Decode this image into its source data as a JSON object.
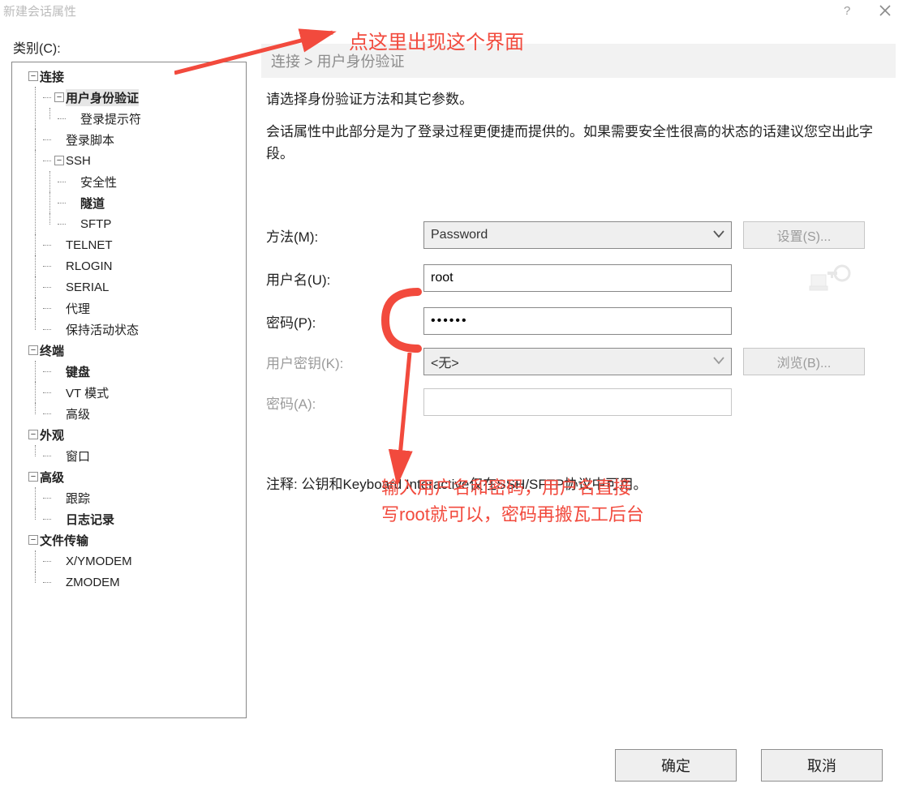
{
  "window": {
    "title": "新建会话属性"
  },
  "sidebar": {
    "label": "类别(C):",
    "tree": {
      "connection": {
        "label": "连接",
        "bold": true
      },
      "auth": {
        "label": "用户身份验证",
        "bold": true,
        "selected": true
      },
      "login_prompt": {
        "label": "登录提示符"
      },
      "login_script": {
        "label": "登录脚本"
      },
      "ssh": {
        "label": "SSH"
      },
      "security": {
        "label": "安全性"
      },
      "tunnel": {
        "label": "隧道",
        "bold": true
      },
      "sftp": {
        "label": "SFTP"
      },
      "telnet": {
        "label": "TELNET"
      },
      "rlogin": {
        "label": "RLOGIN"
      },
      "serial": {
        "label": "SERIAL"
      },
      "proxy": {
        "label": "代理"
      },
      "keepalive": {
        "label": "保持活动状态"
      },
      "terminal": {
        "label": "终端",
        "bold": true
      },
      "keyboard": {
        "label": "键盘",
        "bold": true
      },
      "vtmode": {
        "label": "VT 模式"
      },
      "advanced_t": {
        "label": "高级"
      },
      "appearance": {
        "label": "外观",
        "bold": true
      },
      "window": {
        "label": "窗口"
      },
      "advanced": {
        "label": "高级",
        "bold": true
      },
      "trace": {
        "label": "跟踪"
      },
      "logging": {
        "label": "日志记录",
        "bold": true
      },
      "filetransfer": {
        "label": "文件传输",
        "bold": true
      },
      "xymodem": {
        "label": "X/YMODEM"
      },
      "zmodem": {
        "label": "ZMODEM"
      }
    }
  },
  "panel": {
    "breadcrumb": "连接 > 用户身份验证",
    "desc_line1": "请选择身份验证方法和其它参数。",
    "desc_line2": "会话属性中此部分是为了登录过程更便捷而提供的。如果需要安全性很高的状态的话建议您空出此字段。",
    "form": {
      "method_label": "方法(M):",
      "method_value": "Password",
      "settings_btn": "设置(S)...",
      "user_label": "用户名(U):",
      "user_value": "root",
      "pass_label": "密码(P):",
      "pass_value": "••••••",
      "userkey_label": "用户密钥(K):",
      "userkey_value": "<无>",
      "browse_btn": "浏览(B)...",
      "passphrase_label": "密码(A):"
    },
    "note": "注释: 公钥和Keyboard Interactive仅在SSH/SFTP协议中可用。"
  },
  "buttons": {
    "ok": "确定",
    "cancel": "取消"
  },
  "annotations": {
    "top": "点这里出现这个界面",
    "mid_line1": "输入用户名和密码，用户名直接",
    "mid_line2": "写root就可以，密码再搬瓦工后台"
  }
}
